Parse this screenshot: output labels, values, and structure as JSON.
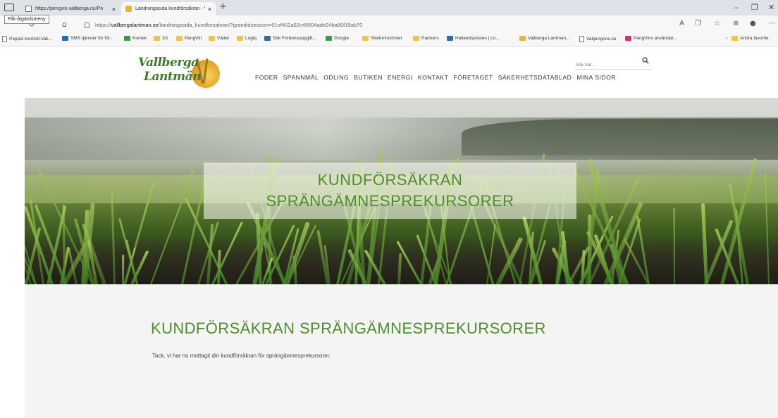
{
  "browser": {
    "tooltip": "Flik-åtgärdsmeny",
    "tabs": [
      {
        "title": "https://pengvin.vallberga.nu/Po",
        "close": "×"
      },
      {
        "title": "Landningssida kundförsäkran - V",
        "close": "×"
      }
    ],
    "new_tab": "+",
    "window_controls": {
      "minimize": "–",
      "restore": "❐",
      "close": "✕"
    },
    "address": {
      "scheme": "https://",
      "host": "vallbergalantman.se",
      "path": "/landningssida_kundforsakran/?grandidsession=01ef402a62c49504ade24ba80f19ab70"
    },
    "bookmarks": [
      {
        "label": "Peppol kontroll-Vali...",
        "icon": "page"
      },
      {
        "label": "SMS tjänster för för...",
        "icon": "blue"
      },
      {
        "label": "Kontek",
        "icon": "green"
      },
      {
        "label": "X3",
        "icon": "folder"
      },
      {
        "label": "PengVin",
        "icon": "folder"
      },
      {
        "label": "Väder",
        "icon": "folder"
      },
      {
        "label": "Logiq",
        "icon": "folder"
      },
      {
        "label": "Sök Fordonsuppgift...",
        "icon": "blue"
      },
      {
        "label": "Google",
        "icon": "green"
      },
      {
        "label": "Telefonnummer",
        "icon": "folder"
      },
      {
        "label": "Partners",
        "icon": "folder"
      },
      {
        "label": "Hallandsposten | Lo...",
        "icon": "blue"
      },
      {
        "label": "Vallberga Lantman...",
        "icon": "vl"
      },
      {
        "label": "Vallprognos.se",
        "icon": "page"
      },
      {
        "label": "PengVins användar...",
        "icon": "pink"
      }
    ],
    "other_favorites": "Andra favorite"
  },
  "site": {
    "logo": {
      "line1": "Vallberga",
      "line2": "Lantmän"
    },
    "search_placeholder": "Sök här...",
    "nav": [
      "FODER",
      "SPANNMÅL",
      "ODLING",
      "BUTIKEN",
      "ENERGI",
      "KONTAKT",
      "FÖRETAGET",
      "SÄKERHETSDATABLAD",
      "MINA SIDOR"
    ],
    "hero": {
      "line1": "KUNDFÖRSÄKRAN",
      "line2": "SPRÄNGÄMNESPREKURSORER"
    },
    "heading": "KUNDFÖRSÄKRAN SPRÄNGÄMNESPREKURSORER",
    "message": "Tack, vi har nu mottagit din kundförsäkran för sprängämnesprekursorer."
  },
  "colors": {
    "brand_green": "#4e8e2c",
    "logo_green": "#3d7d2a",
    "sun": "#e8a623"
  }
}
